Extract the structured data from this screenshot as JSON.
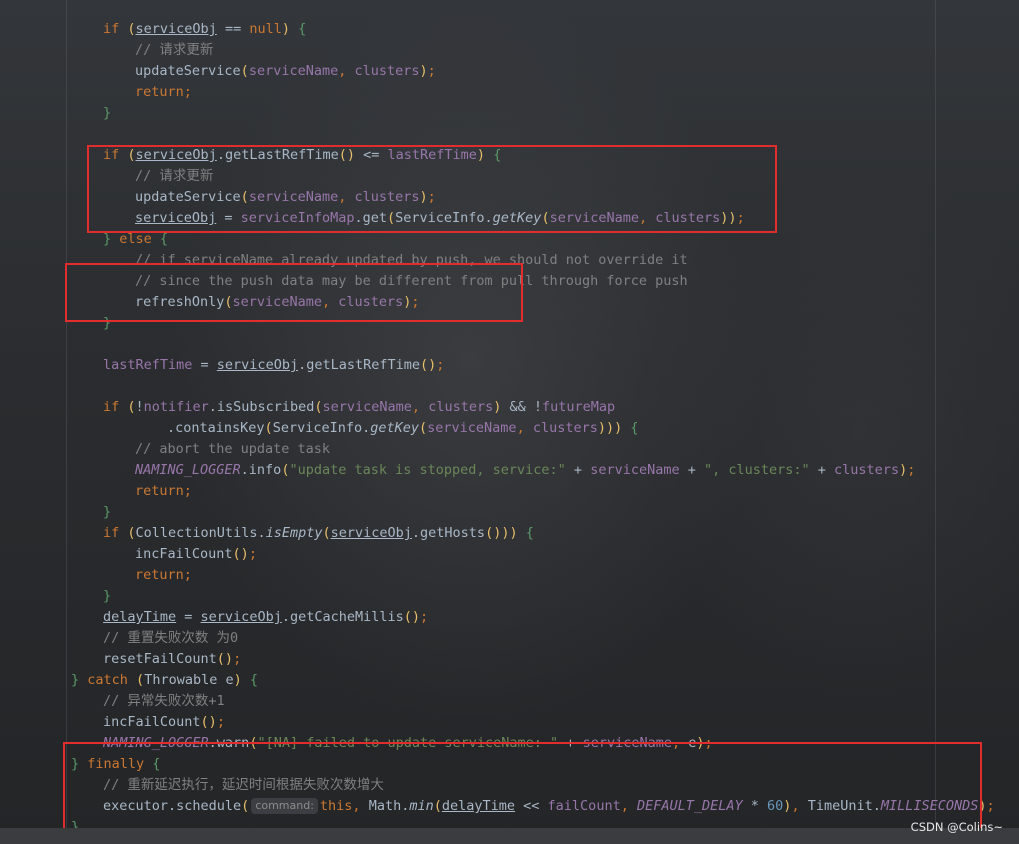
{
  "editor": {
    "lines": [
      {
        "i": 1,
        "t": [
          {
            "k": "kw",
            "v": "if "
          },
          {
            "k": "par",
            "v": "("
          },
          {
            "k": "ul",
            "v": "serviceObj"
          },
          {
            "v": " == "
          },
          {
            "k": "kw",
            "v": "null"
          },
          {
            "k": "par",
            "v": ")"
          },
          {
            "k": "brc",
            "v": " {"
          }
        ]
      },
      {
        "i": 2,
        "t": [
          {
            "k": "cm",
            "v": "// 请求更新"
          }
        ]
      },
      {
        "i": 2,
        "t": [
          {
            "v": "updateService"
          },
          {
            "k": "par",
            "v": "("
          },
          {
            "k": "fld",
            "v": "serviceName"
          },
          {
            "k": "kw",
            "v": ", "
          },
          {
            "k": "fld",
            "v": "clusters"
          },
          {
            "k": "par",
            "v": ")"
          },
          {
            "k": "kw",
            "v": ";"
          }
        ]
      },
      {
        "i": 2,
        "t": [
          {
            "k": "kw",
            "v": "return;"
          }
        ]
      },
      {
        "i": 1,
        "t": [
          {
            "k": "brc",
            "v": "}"
          }
        ]
      },
      {
        "i": 0,
        "t": []
      },
      {
        "i": 1,
        "t": [
          {
            "k": "kw",
            "v": "if "
          },
          {
            "k": "par",
            "v": "("
          },
          {
            "k": "ul",
            "v": "serviceObj"
          },
          {
            "v": ".getLastRefTime"
          },
          {
            "k": "par",
            "v": "()"
          },
          {
            "v": " <= "
          },
          {
            "k": "fld",
            "v": "lastRefTime"
          },
          {
            "k": "par",
            "v": ")"
          },
          {
            "k": "brc",
            "v": " {"
          }
        ]
      },
      {
        "i": 2,
        "t": [
          {
            "k": "cm",
            "v": "// 请求更新"
          }
        ]
      },
      {
        "i": 2,
        "t": [
          {
            "v": "updateService"
          },
          {
            "k": "par",
            "v": "("
          },
          {
            "k": "fld",
            "v": "serviceName"
          },
          {
            "k": "kw",
            "v": ", "
          },
          {
            "k": "fld",
            "v": "clusters"
          },
          {
            "k": "par",
            "v": ")"
          },
          {
            "k": "kw",
            "v": ";"
          }
        ]
      },
      {
        "i": 2,
        "t": [
          {
            "k": "ul",
            "v": "serviceObj"
          },
          {
            "v": " = "
          },
          {
            "k": "fld",
            "v": "serviceInfoMap"
          },
          {
            "v": ".get"
          },
          {
            "k": "par",
            "v": "("
          },
          {
            "v": "ServiceInfo."
          },
          {
            "k": "it",
            "v": "getKey"
          },
          {
            "k": "par",
            "v": "("
          },
          {
            "k": "fld",
            "v": "serviceName"
          },
          {
            "k": "kw",
            "v": ", "
          },
          {
            "k": "fld",
            "v": "clusters"
          },
          {
            "k": "par",
            "v": "))"
          },
          {
            "k": "kw",
            "v": ";"
          }
        ]
      },
      {
        "i": 1,
        "t": [
          {
            "k": "brc",
            "v": "} "
          },
          {
            "k": "kw",
            "v": "else"
          },
          {
            "k": "brc",
            "v": " {"
          }
        ]
      },
      {
        "i": 2,
        "t": [
          {
            "k": "cm",
            "v": "// if serviceName already updated by push, we should not override it"
          }
        ]
      },
      {
        "i": 2,
        "t": [
          {
            "k": "cm",
            "v": "// since the push data may be different from pull through force push"
          }
        ]
      },
      {
        "i": 2,
        "t": [
          {
            "v": "refreshOnly"
          },
          {
            "k": "par",
            "v": "("
          },
          {
            "k": "fld",
            "v": "serviceName"
          },
          {
            "k": "kw",
            "v": ", "
          },
          {
            "k": "fld",
            "v": "clusters"
          },
          {
            "k": "par",
            "v": ")"
          },
          {
            "k": "kw",
            "v": ";"
          }
        ]
      },
      {
        "i": 1,
        "t": [
          {
            "k": "brc",
            "v": "}"
          }
        ]
      },
      {
        "i": 0,
        "t": []
      },
      {
        "i": 1,
        "t": [
          {
            "k": "fld",
            "v": "lastRefTime"
          },
          {
            "v": " = "
          },
          {
            "k": "ul",
            "v": "serviceObj"
          },
          {
            "v": ".getLastRefTime"
          },
          {
            "k": "par",
            "v": "()"
          },
          {
            "k": "kw",
            "v": ";"
          }
        ]
      },
      {
        "i": 0,
        "t": []
      },
      {
        "i": 1,
        "t": [
          {
            "k": "kw",
            "v": "if "
          },
          {
            "k": "par",
            "v": "("
          },
          {
            "v": "!"
          },
          {
            "k": "fld",
            "v": "notifier"
          },
          {
            "v": ".isSubscribed"
          },
          {
            "k": "par",
            "v": "("
          },
          {
            "k": "fld",
            "v": "serviceName"
          },
          {
            "k": "kw",
            "v": ", "
          },
          {
            "k": "fld",
            "v": "clusters"
          },
          {
            "k": "par",
            "v": ")"
          },
          {
            "v": " && !"
          },
          {
            "k": "fld",
            "v": "futureMap"
          }
        ]
      },
      {
        "i": 3,
        "t": [
          {
            "v": ".containsKey"
          },
          {
            "k": "par",
            "v": "("
          },
          {
            "v": "ServiceInfo."
          },
          {
            "k": "it",
            "v": "getKey"
          },
          {
            "k": "par",
            "v": "("
          },
          {
            "k": "fld",
            "v": "serviceName"
          },
          {
            "k": "kw",
            "v": ", "
          },
          {
            "k": "fld",
            "v": "clusters"
          },
          {
            "k": "par",
            "v": ")))"
          },
          {
            "k": "brc",
            "v": " {"
          }
        ]
      },
      {
        "i": 2,
        "t": [
          {
            "k": "cm",
            "v": "// abort the update task"
          }
        ]
      },
      {
        "i": 2,
        "t": [
          {
            "k": "fld it",
            "v": "NAMING_LOGGER"
          },
          {
            "v": ".info"
          },
          {
            "k": "par",
            "v": "("
          },
          {
            "k": "str",
            "v": "\"update task is stopped, service:\""
          },
          {
            "v": " + "
          },
          {
            "k": "fld",
            "v": "serviceName"
          },
          {
            "v": " + "
          },
          {
            "k": "str",
            "v": "\", clusters:\""
          },
          {
            "v": " + "
          },
          {
            "k": "fld",
            "v": "clusters"
          },
          {
            "k": "par",
            "v": ")"
          },
          {
            "k": "kw",
            "v": ";"
          }
        ]
      },
      {
        "i": 2,
        "t": [
          {
            "k": "kw",
            "v": "return;"
          }
        ]
      },
      {
        "i": 1,
        "t": [
          {
            "k": "brc",
            "v": "}"
          }
        ]
      },
      {
        "i": 1,
        "t": [
          {
            "k": "kw",
            "v": "if "
          },
          {
            "k": "par",
            "v": "("
          },
          {
            "v": "CollectionUtils."
          },
          {
            "k": "it",
            "v": "isEmpty"
          },
          {
            "k": "par",
            "v": "("
          },
          {
            "k": "ul",
            "v": "serviceObj"
          },
          {
            "v": ".getHosts"
          },
          {
            "k": "par",
            "v": "()))"
          },
          {
            "k": "brc",
            "v": " {"
          }
        ]
      },
      {
        "i": 2,
        "t": [
          {
            "v": "incFailCount"
          },
          {
            "k": "par",
            "v": "()"
          },
          {
            "k": "kw",
            "v": ";"
          }
        ]
      },
      {
        "i": 2,
        "t": [
          {
            "k": "kw",
            "v": "return;"
          }
        ]
      },
      {
        "i": 1,
        "t": [
          {
            "k": "brc",
            "v": "}"
          }
        ]
      },
      {
        "i": 1,
        "t": [
          {
            "k": "ul",
            "v": "delayTime"
          },
          {
            "v": " = "
          },
          {
            "k": "ul",
            "v": "serviceObj"
          },
          {
            "v": ".getCacheMillis"
          },
          {
            "k": "par",
            "v": "()"
          },
          {
            "k": "kw",
            "v": ";"
          }
        ]
      },
      {
        "i": 1,
        "t": [
          {
            "k": "cm",
            "v": "// 重置失败次数 为0"
          }
        ]
      },
      {
        "i": 1,
        "t": [
          {
            "v": "resetFailCount"
          },
          {
            "k": "par",
            "v": "()"
          },
          {
            "k": "kw",
            "v": ";"
          }
        ]
      },
      {
        "i": 0,
        "t": [
          {
            "k": "brc",
            "v": "} "
          },
          {
            "k": "kw",
            "v": "catch "
          },
          {
            "k": "par",
            "v": "("
          },
          {
            "v": "Throwable e"
          },
          {
            "k": "par",
            "v": ")"
          },
          {
            "k": "brc",
            "v": " {"
          }
        ]
      },
      {
        "i": 1,
        "t": [
          {
            "k": "cm",
            "v": "// 异常失败次数+1"
          }
        ]
      },
      {
        "i": 1,
        "t": [
          {
            "v": "incFailCount"
          },
          {
            "k": "par",
            "v": "()"
          },
          {
            "k": "kw",
            "v": ";"
          }
        ]
      },
      {
        "i": 1,
        "t": [
          {
            "k": "fld it",
            "v": "NAMING_LOGGER"
          },
          {
            "v": ".warn"
          },
          {
            "k": "par",
            "v": "("
          },
          {
            "k": "str",
            "v": "\"[NA] failed to update serviceName: \""
          },
          {
            "v": " + "
          },
          {
            "k": "fld",
            "v": "serviceName"
          },
          {
            "k": "kw",
            "v": ", "
          },
          {
            "v": "e"
          },
          {
            "k": "par",
            "v": ")"
          },
          {
            "k": "kw",
            "v": ";"
          }
        ]
      },
      {
        "i": 0,
        "t": [
          {
            "k": "brc",
            "v": "} "
          },
          {
            "k": "kw",
            "v": "finally"
          },
          {
            "k": "brc",
            "v": " {"
          }
        ]
      },
      {
        "i": 1,
        "t": [
          {
            "k": "cm",
            "v": "// 重新延迟执行，延迟时间根据失败次数增大"
          }
        ]
      },
      {
        "i": 1,
        "t": [
          {
            "v": "executor.schedule"
          },
          {
            "k": "par",
            "v": "("
          },
          {
            "k": "hint",
            "v": "command:"
          },
          {
            "k": "kw",
            "v": "this, "
          },
          {
            "v": "Math."
          },
          {
            "k": "it",
            "v": "min"
          },
          {
            "k": "par",
            "v": "("
          },
          {
            "k": "ul",
            "v": "delayTime"
          },
          {
            "v": " << "
          },
          {
            "k": "fld",
            "v": "failCount"
          },
          {
            "k": "kw",
            "v": ", "
          },
          {
            "k": "fld it",
            "v": "DEFAULT_DELAY"
          },
          {
            "v": " * "
          },
          {
            "k": "num",
            "v": "60"
          },
          {
            "k": "par",
            "v": ")"
          },
          {
            "k": "kw",
            "v": ", "
          },
          {
            "v": "TimeUnit."
          },
          {
            "k": "fld it",
            "v": "MILLISECONDS"
          },
          {
            "k": "par",
            "v": ")"
          },
          {
            "k": "kw",
            "v": ";"
          }
        ]
      },
      {
        "i": 0,
        "t": [
          {
            "k": "brc",
            "v": "}"
          }
        ]
      }
    ]
  },
  "highlights": [
    "refresh-block",
    "else-block",
    "finally-block"
  ],
  "watermark": "CSDN @Colins~",
  "colors": {
    "highlight_border": "#e12d2d",
    "keyword": "#cc7832",
    "field": "#9876aa",
    "comment": "#808080",
    "string": "#6a8759"
  }
}
